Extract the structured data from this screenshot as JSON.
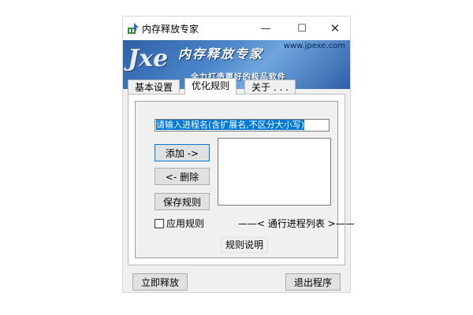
{
  "window": {
    "title": "内存释放专家",
    "minimize_symbol": "—",
    "maximize_symbol": "☐",
    "close_symbol": "✕"
  },
  "banner": {
    "logo": "Jxe",
    "title": "内存释放专家",
    "url": "www.jpexe.com",
    "slogan": "全力打造更好的极品软件"
  },
  "tabs": [
    {
      "label": "基本设置",
      "active": false
    },
    {
      "label": "优化规则",
      "active": true
    },
    {
      "label": "关于 . . .",
      "active": false
    }
  ],
  "rules": {
    "input_value": "请输入进程名(含扩展名,不区分大小写)",
    "add_button": "添加 ->",
    "delete_button": "<- 删除",
    "save_button": "保存规则",
    "apply_checkbox": "应用规则",
    "apply_checked": false,
    "list_label": "——< 通行进程列表 >——",
    "explain_button": "规则说明"
  },
  "footer": {
    "release_button": "立即释放",
    "exit_button": "退出程序"
  },
  "colors": {
    "selection": "#0078d7",
    "banner": "#2f5fa8"
  }
}
